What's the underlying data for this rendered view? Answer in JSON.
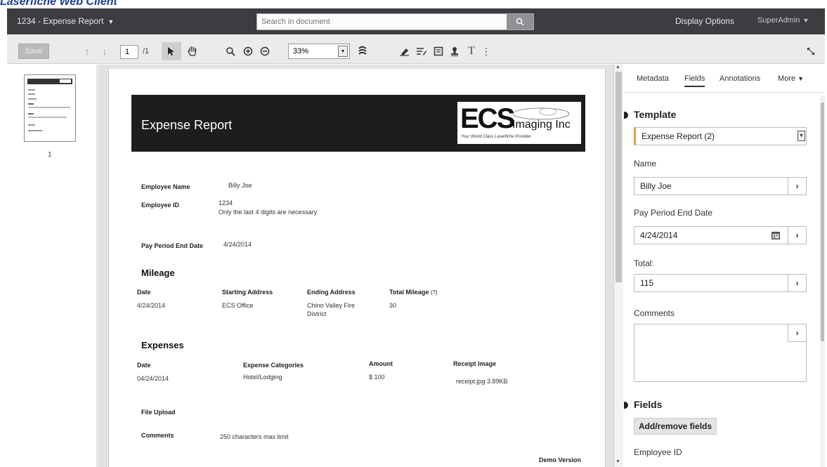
{
  "caption": "Laserfiche Web Client",
  "topbar": {
    "doc_title": "1234 - Expense Report",
    "search_placeholder": "Search in document",
    "display_options": "Display Options",
    "user": "SuperAdmin"
  },
  "toolbar": {
    "save_label": "Save",
    "page_current": "1",
    "page_total": "/1",
    "zoom": "33%",
    "text_tool": "T",
    "more": "⋮"
  },
  "thumbnails": {
    "page_number": "1"
  },
  "document": {
    "header_title": "Expense Report",
    "logo_ecs": "ECS",
    "logo_imaging": "Imaging Inc",
    "logo_tagline": "Your World Class Laserfiche Provider",
    "employee_name_label": "Employee Name",
    "employee_name_value": "Billy Joe",
    "employee_id_label": "Employee ID",
    "employee_id_value": "1234",
    "employee_id_note": "Only the last 4 digits are necessary",
    "pay_period_label": "Pay Period End Date",
    "pay_period_value": "4/24/2014",
    "mileage": {
      "title": "Mileage",
      "col_date": "Date",
      "col_start": "Starting Address",
      "col_end": "Ending Address",
      "col_total": "Total Mileage",
      "col_total_hint": "(?)",
      "date": "4/24/2014",
      "start": "ECS Office",
      "end_line1": "Chino Valley Fire",
      "end_line2": "District",
      "total": "30"
    },
    "expenses": {
      "title": "Expenses",
      "col_date": "Date",
      "col_category": "Expense Categories",
      "col_amount": "Amount",
      "col_receipt": "Receipt Image",
      "date": "04/24/2014",
      "category": "Hotel/Lodging",
      "amount": "$ 100",
      "receipt": "receipt.jpg  3.89KB"
    },
    "file_upload_label": "File Upload",
    "comments_label": "Comments",
    "comments_value": "250 characters max limit",
    "demo": "Demo Version"
  },
  "right_panel": {
    "tabs": [
      "Metadata",
      "Fields",
      "Annotations",
      "More"
    ],
    "template_heading": "Template",
    "template_value": "Expense Report (2)",
    "name_label": "Name",
    "name_value": "Billy Joe",
    "pay_period_label": "Pay Period End Date",
    "pay_period_value": "4/24/2014",
    "total_label": "Total:",
    "total_value": "115",
    "comments_label": "Comments",
    "fields_heading": "Fields",
    "add_remove_label": "Add/remove fields",
    "employee_id_label": "Employee ID"
  },
  "colors": {
    "topbar": "#3b3d41",
    "toolbar": "#ebebeb",
    "header_band": "#1d1d1d"
  }
}
